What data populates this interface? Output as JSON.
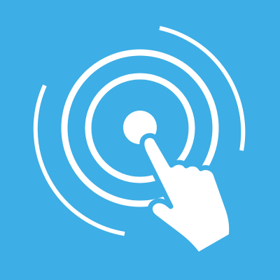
{
  "icon": {
    "name": "tap-touch-icon",
    "colors": {
      "background": "#3DAEE6",
      "foreground": "#FFFFFF"
    }
  }
}
